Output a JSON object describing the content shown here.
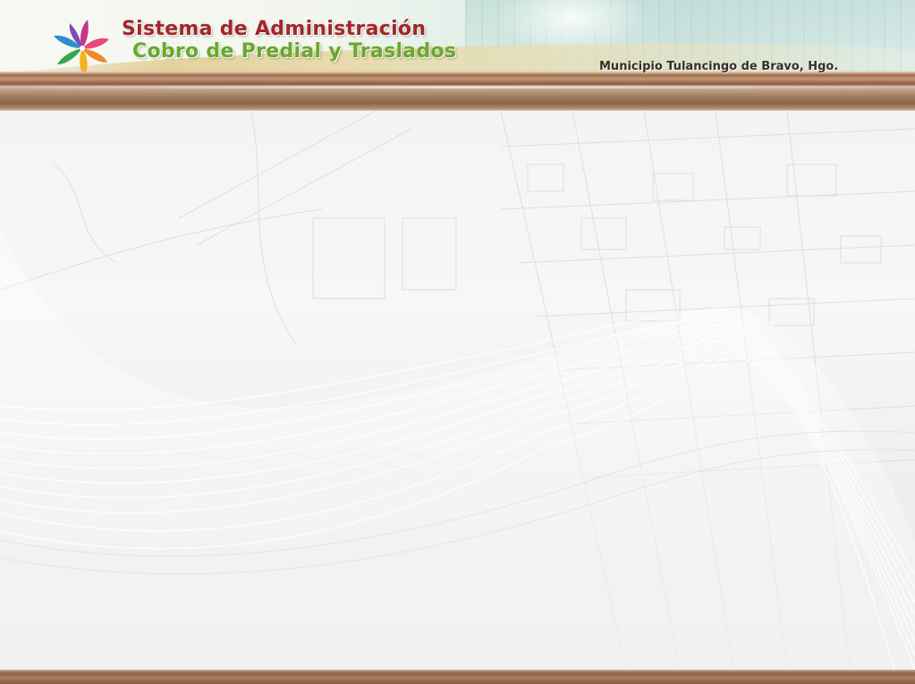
{
  "header": {
    "title_line1": "Sistema de Administración",
    "title_line2": "Cobro de Predial y Traslados",
    "municipality": "Municipio Tulancingo de Bravo, Hgo.",
    "logo_icon": "flower-pinwheel-logo-icon"
  },
  "colors": {
    "title_red": "#a3262a",
    "title_green": "#6aa82a",
    "bar_brown": "#8b5a3c",
    "background": "#f2f2f2"
  }
}
